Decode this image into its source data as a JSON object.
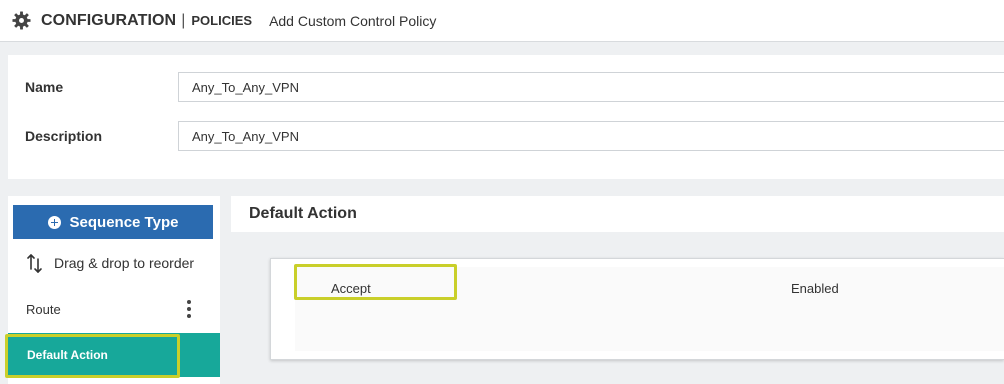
{
  "header": {
    "title": "CONFIGURATION",
    "separator": "|",
    "section": "POLICIES",
    "page": "Add Custom Control Policy",
    "icon": "gear-icon"
  },
  "form": {
    "name_label": "Name",
    "name_value": "Any_To_Any_VPN",
    "description_label": "Description",
    "description_value": "Any_To_Any_VPN"
  },
  "sidebar": {
    "sequence_button": "Sequence Type",
    "drag_hint": "Drag & drop to reorder",
    "items": [
      {
        "label": "Route"
      },
      {
        "label": "Default Action"
      }
    ]
  },
  "default_action": {
    "title": "Default Action",
    "action": "Accept",
    "status": "Enabled"
  },
  "colors": {
    "primary": "#2b6bb0",
    "active": "#17a89a",
    "highlight": "#c9cf2a"
  }
}
